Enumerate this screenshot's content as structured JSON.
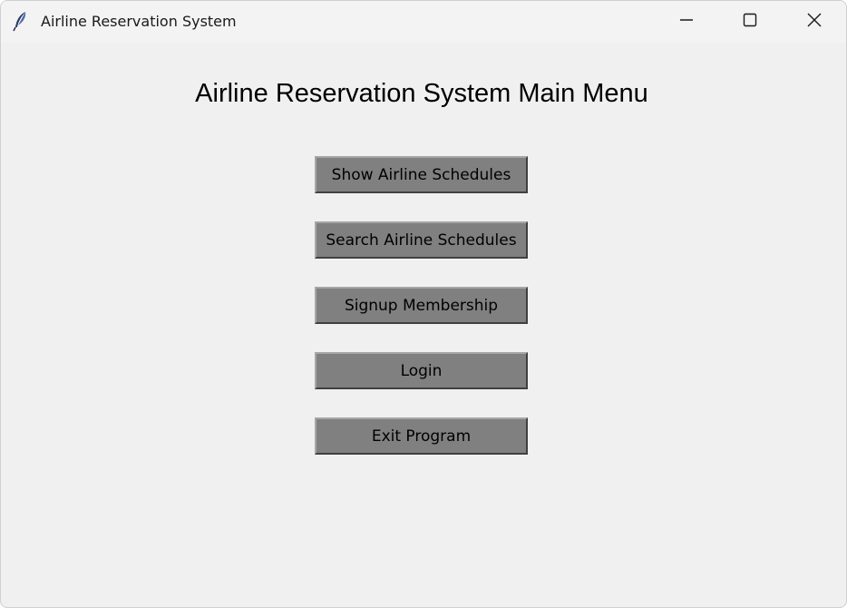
{
  "window": {
    "title": "Airline Reservation System",
    "icon": "feather-icon",
    "controls": {
      "minimize": "minimize-icon",
      "maximize": "maximize-icon",
      "close": "close-icon"
    }
  },
  "main": {
    "heading": "Airline Reservation System Main Menu",
    "buttons": [
      {
        "label": "Show Airline Schedules"
      },
      {
        "label": "Search Airline Schedules"
      },
      {
        "label": "Signup Membership"
      },
      {
        "label": "Login"
      },
      {
        "label": "Exit Program"
      }
    ]
  },
  "colors": {
    "window_bg": "#f0f0f0",
    "button_bg": "#808080",
    "text": "#000000"
  }
}
